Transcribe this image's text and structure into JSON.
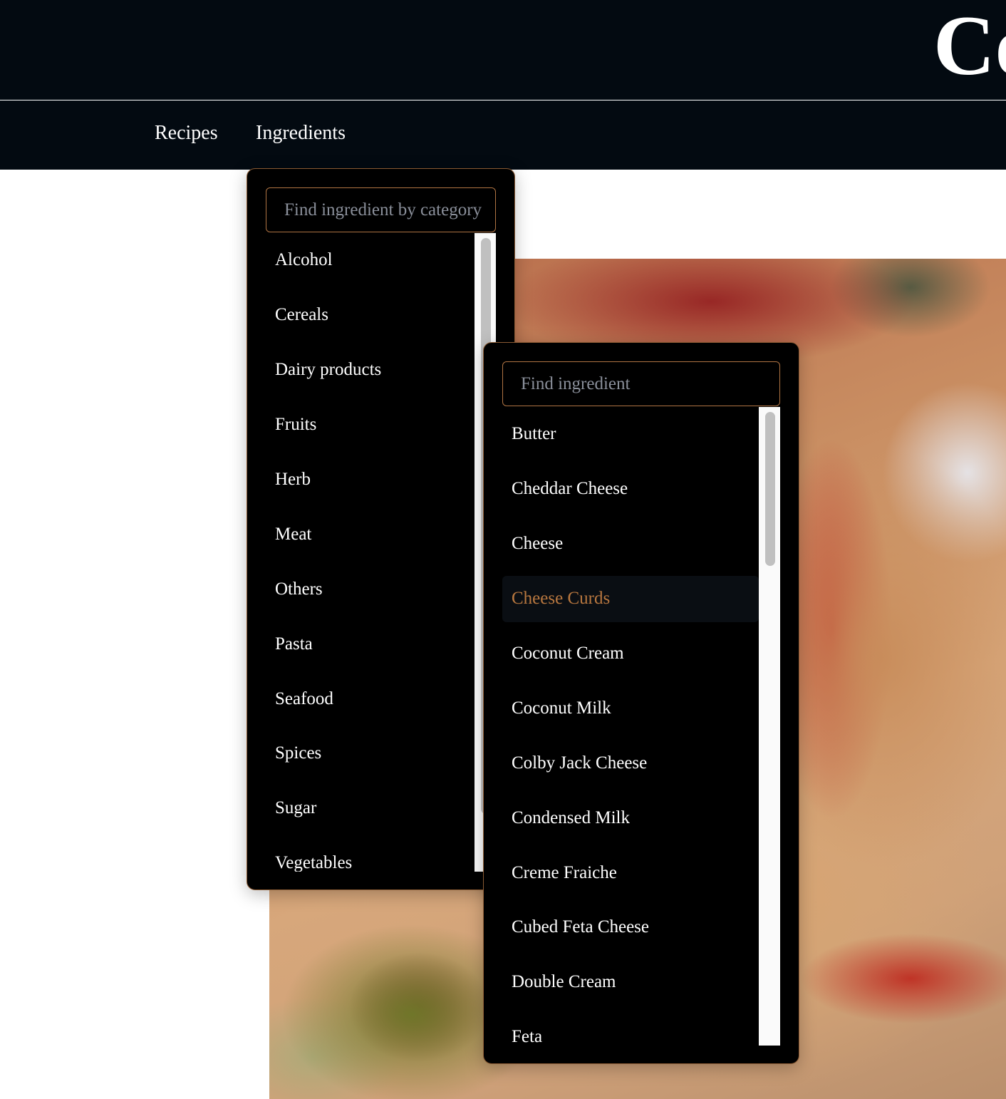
{
  "header": {
    "logo_text": "Co"
  },
  "nav": {
    "items": [
      {
        "label": "Recipes"
      },
      {
        "label": "Ingredients"
      }
    ]
  },
  "category_dropdown": {
    "search_placeholder": "Find ingredient by category",
    "items": [
      {
        "label": "Alcohol"
      },
      {
        "label": "Cereals"
      },
      {
        "label": "Dairy products"
      },
      {
        "label": "Fruits"
      },
      {
        "label": "Herb"
      },
      {
        "label": "Meat"
      },
      {
        "label": "Others"
      },
      {
        "label": "Pasta"
      },
      {
        "label": "Seafood"
      },
      {
        "label": "Spices"
      },
      {
        "label": "Sugar"
      },
      {
        "label": "Vegetables"
      }
    ]
  },
  "ingredient_dropdown": {
    "search_placeholder": "Find ingredient",
    "items": [
      {
        "label": "Butter"
      },
      {
        "label": "Cheddar Cheese"
      },
      {
        "label": "Cheese"
      },
      {
        "label": "Cheese Curds",
        "active": true
      },
      {
        "label": "Coconut Cream"
      },
      {
        "label": "Coconut Milk"
      },
      {
        "label": "Colby Jack Cheese"
      },
      {
        "label": "Condensed Milk"
      },
      {
        "label": "Creme Fraiche"
      },
      {
        "label": "Cubed Feta Cheese"
      },
      {
        "label": "Double Cream"
      },
      {
        "label": "Feta"
      }
    ]
  },
  "colors": {
    "nav_bg": "#030a11",
    "panel_bg": "#000000",
    "accent": "#b8773f",
    "panel_border": "#8a5a33"
  }
}
